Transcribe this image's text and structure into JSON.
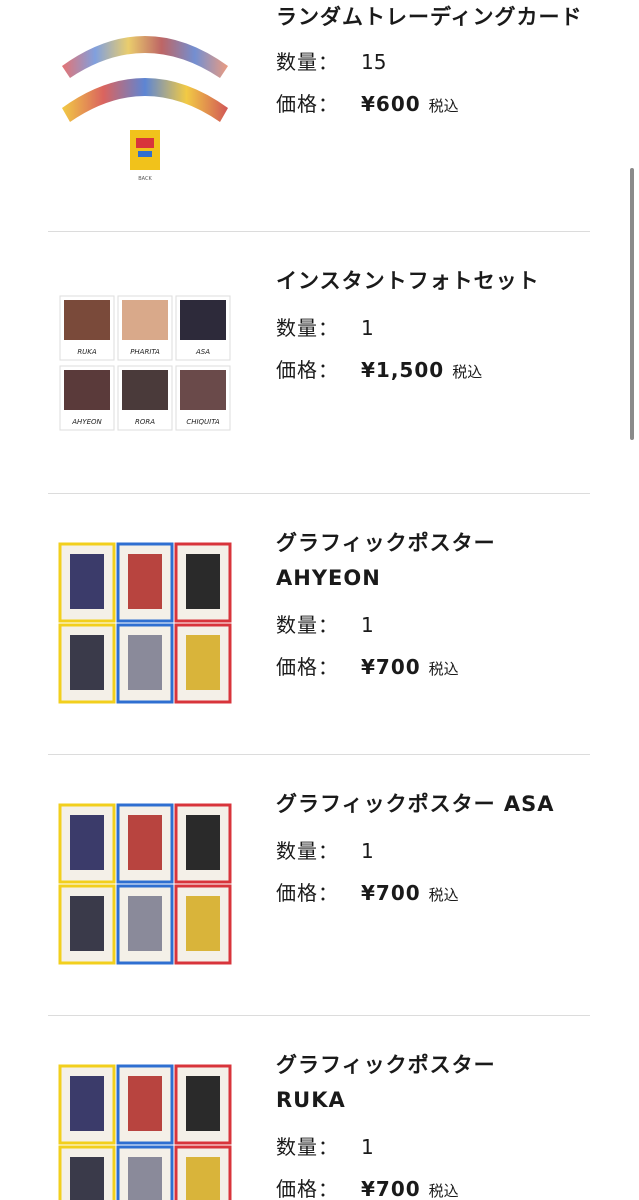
{
  "labels": {
    "qty": "数量：",
    "price": "価格：",
    "tax": "税込"
  },
  "products": [
    {
      "name": "ランダムトレーディングカード",
      "qty": "15",
      "price": "¥600",
      "thumb": "random-trading-card-fan-icon",
      "card_back_text": "BACK"
    },
    {
      "name": "インスタントフォトセット",
      "qty": "1",
      "price": "¥1,500",
      "thumb": "instant-photo-grid-icon",
      "photo_captions": [
        "RUKA",
        "PHARITA",
        "ASA",
        "AHYEON",
        "RORA",
        "CHIQUITA"
      ]
    },
    {
      "name": "グラフィックポスター AHYEON",
      "qty": "1",
      "price": "¥700",
      "thumb": "poster-grid-icon"
    },
    {
      "name": "グラフィックポスター ASA",
      "qty": "1",
      "price": "¥700",
      "thumb": "poster-grid-icon"
    },
    {
      "name": "グラフィックポスター RUKA",
      "qty": "1",
      "price": "¥700",
      "thumb": "poster-grid-icon"
    }
  ],
  "colors": {
    "poster_yellow": "#f2cf1d",
    "poster_blue": "#2f6fd1",
    "poster_red": "#d8343b",
    "divider": "#dcdcdc"
  }
}
